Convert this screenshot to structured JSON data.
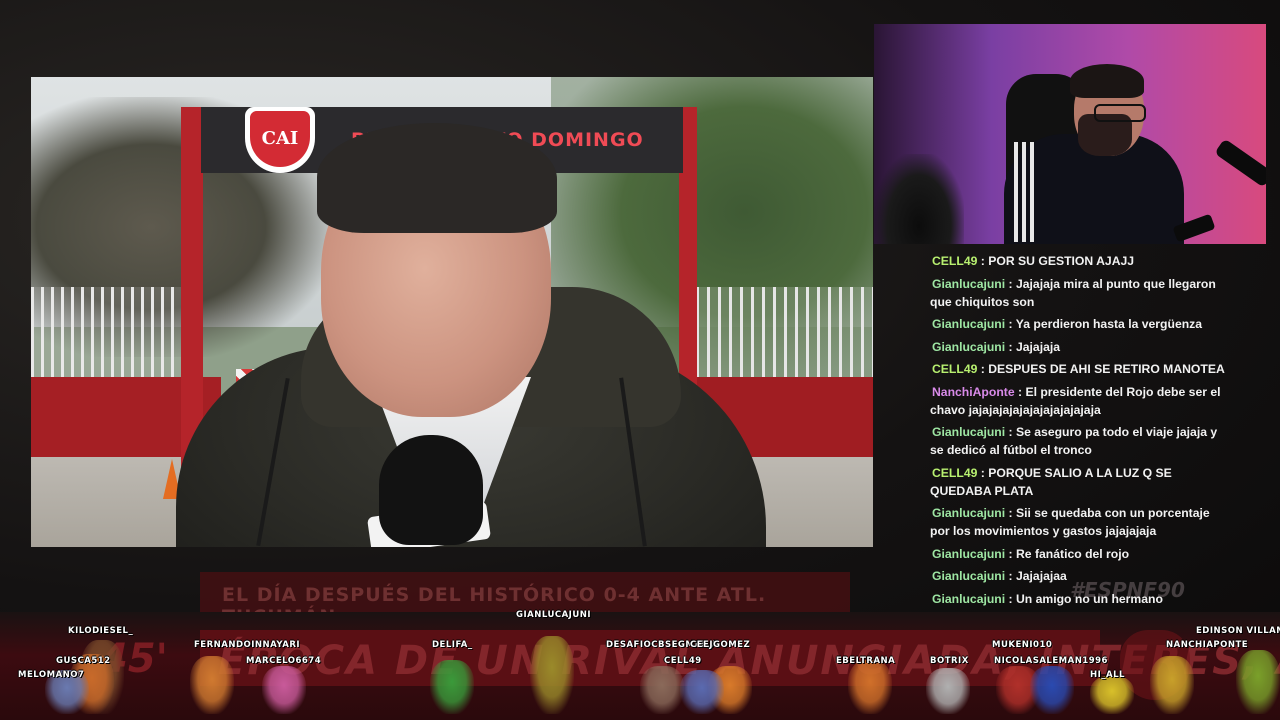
{
  "background": {
    "banner_text": "EL DÍA DESPUÉS DEL HISTÓRICO 0-4 ANTE ATL. TUCUMÁN",
    "hashtag": "#ESPNF90",
    "minute": "45'",
    "headline": "ÉPOCA DE UN RIVAL ANUNCIADA, INTERES, AFUERA DEL ROJO"
  },
  "video": {
    "gate_shield_text": "CAI",
    "gate_sign_text": "PREDIO SANTO DOMINGO"
  },
  "chat": {
    "messages": [
      {
        "user": "CELL49",
        "color": "#b8f070",
        "text": "POR SU GESTION AJAJJ"
      },
      {
        "user": "Gianlucajuni",
        "color": "#9ee6a3",
        "text": "Jajajaja mira al punto que llegaron que chiquitos son"
      },
      {
        "user": "Gianlucajuni",
        "color": "#9ee6a3",
        "text": "Ya perdieron hasta la vergüenza"
      },
      {
        "user": "Gianlucajuni",
        "color": "#9ee6a3",
        "text": "Jajajaja"
      },
      {
        "user": "CELL49",
        "color": "#b8f070",
        "text": "DESPUES DE AHI SE RETIRO MANOTEA"
      },
      {
        "user": "NanchiAponte",
        "color": "#d88ae8",
        "text": "El presidente del Rojo debe ser el chavo jajajajajajajajajajajajaja"
      },
      {
        "user": "Gianlucajuni",
        "color": "#9ee6a3",
        "text": "Se aseguro pa todo el viaje jajaja y se dedicó al fútbol el tronco"
      },
      {
        "user": "CELL49",
        "color": "#b8f070",
        "text": "PORQUE SALIO A LA LUZ Q SE QUEDABA PLATA"
      },
      {
        "user": "Gianlucajuni",
        "color": "#9ee6a3",
        "text": "Sii se quedaba con un porcentaje por los movimientos y gastos jajajajaja"
      },
      {
        "user": "Gianlucajuni",
        "color": "#9ee6a3",
        "text": "Re fanático del rojo"
      },
      {
        "user": "Gianlucajuni",
        "color": "#9ee6a3",
        "text": "Jajajajaa"
      },
      {
        "user": "Gianlucajuni",
        "color": "#9ee6a3",
        "text": "Un amigo no un hermano"
      }
    ],
    "separator": " : "
  },
  "viewers": [
    {
      "name": "KILODIESEL_",
      "color": "#7a4a2a"
    },
    {
      "name": "GUSCA512",
      "color": "#c86a2a"
    },
    {
      "name": "MELOMANO7",
      "color": "#6a7ab0"
    },
    {
      "name": "FERNANDOINNAYARI",
      "color": "#d07a30"
    },
    {
      "name": "MARCELO6674",
      "color": "#c85a9a"
    },
    {
      "name": "DELIFA_",
      "color": "#3a9a3a"
    },
    {
      "name": "GIANLUCAJUNI",
      "color": "#9a8a2a"
    },
    {
      "name": "DESAFIOCBSEGMAILA",
      "color": "#8a6a5a"
    },
    {
      "name": "CEEJGOMEZ",
      "color": "#d87a2a"
    },
    {
      "name": "CELL49",
      "color": "#5a6ab0"
    },
    {
      "name": "EBELTRANA",
      "color": "#d0702a"
    },
    {
      "name": "BOTRIX",
      "color": "#b0b0b0"
    },
    {
      "name": "MUKENI010",
      "color": "#b0302a"
    },
    {
      "name": "NICOLASALEMAN1996",
      "color": "#2a4ab0"
    },
    {
      "name": "HI_ALL",
      "color": "#d8c02a"
    },
    {
      "name": "EDINSON VILLAMIZ",
      "color": "#c8a02a"
    },
    {
      "name": "NANCHIAPONTE",
      "color": "#7aa02a"
    }
  ]
}
